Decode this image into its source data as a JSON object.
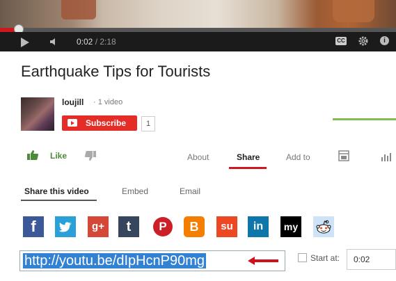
{
  "player": {
    "current_time": "0:02",
    "separator": " / ",
    "total_time": "2:18",
    "progress_fraction": 0.015,
    "cc_label": "CC",
    "info_label": "i"
  },
  "video": {
    "title": "Earthquake Tips for Tourists"
  },
  "channel": {
    "username": "loujill",
    "video_count": "· 1 video",
    "subscribe_label": "Subscribe",
    "subscriber_count": "1"
  },
  "actions": {
    "like_label": "Like",
    "tabs": {
      "about": "About",
      "share": "Share",
      "add_to": "Add to"
    }
  },
  "share": {
    "tabs": {
      "share_video": "Share this video",
      "embed": "Embed",
      "email": "Email"
    },
    "social": {
      "facebook": "f",
      "twitter": "t",
      "google_plus": "g+",
      "tumblr": "t",
      "pinterest": "P",
      "blogger": "B",
      "stumbleupon": "su",
      "linkedin": "in",
      "myspace": "my"
    },
    "url": "http://youtu.be/dIpHcnP90mg",
    "start_at_label": "Start at:",
    "start_at_value": "0:02"
  },
  "colors": {
    "accent_red": "#cc181e",
    "subscribe_red": "#e52d27",
    "like_green": "#4c8b3a",
    "selection_blue": "#3381d3"
  }
}
